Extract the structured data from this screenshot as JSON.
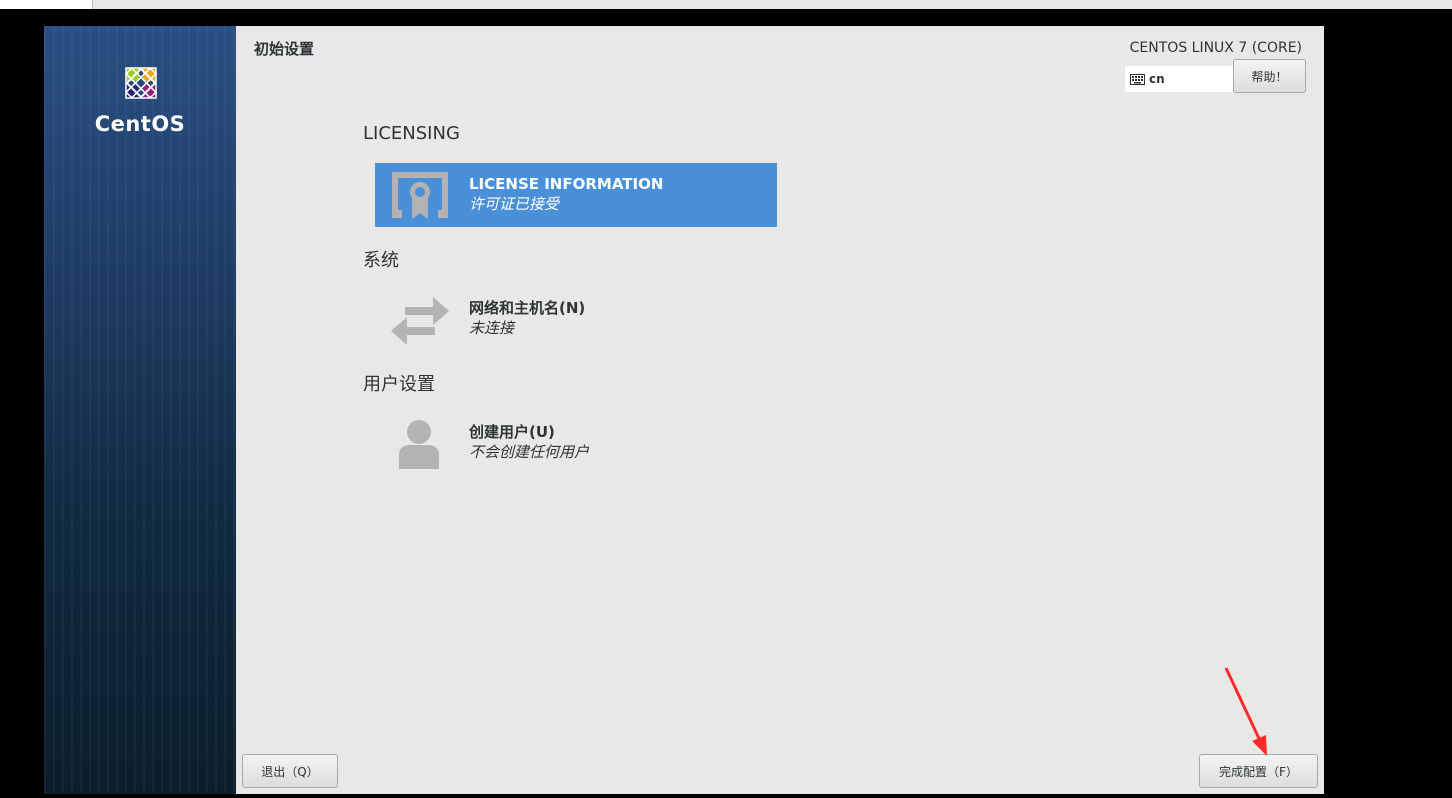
{
  "colors": {
    "selection": "#4a90d9",
    "annotation_arrow": "#ff2a2a",
    "panel_bg": "#e8e8e7"
  },
  "sidebar": {
    "logo_text": "CentOS",
    "logo_icon": "centos-logo-icon"
  },
  "header": {
    "title": "初始设置",
    "product": "CENTOS LINUX 7 (CORE)",
    "keyboard_layout": "cn",
    "help_button": "帮助！"
  },
  "sections": {
    "licensing": {
      "title": "LICENSING",
      "spoke": {
        "name": "LICENSE INFORMATION",
        "status": "许可证已接受",
        "icon": "certificate-icon"
      }
    },
    "system": {
      "title": "系统",
      "spoke": {
        "name": "网络和主机名(N)",
        "status": "未连接",
        "icon": "network-arrows-icon"
      }
    },
    "user": {
      "title": "用户设置",
      "spoke": {
        "name": "创建用户(U)",
        "status": "不会创建任何用户",
        "icon": "user-icon"
      }
    }
  },
  "footer": {
    "quit_button": "退出（Q）",
    "finish_button": "完成配置（F）"
  }
}
